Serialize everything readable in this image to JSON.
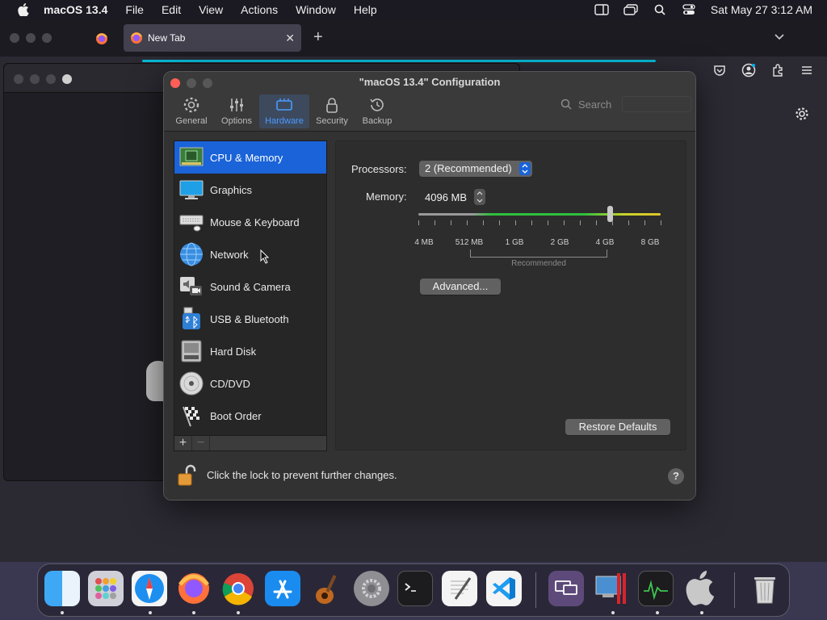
{
  "menubar": {
    "app_name": "macOS 13.4",
    "menus": [
      "File",
      "Edit",
      "View",
      "Actions",
      "Window",
      "Help"
    ],
    "datetime": "Sat May 27  3:12 AM"
  },
  "browser": {
    "tab_title": "New Tab",
    "tab_close": "✕",
    "new_tab": "+"
  },
  "dialog": {
    "title": "\"macOS 13.4\" Configuration",
    "toolbar": [
      {
        "label": "General",
        "icon": "gear-icon"
      },
      {
        "label": "Options",
        "icon": "sliders-icon"
      },
      {
        "label": "Hardware",
        "icon": "chip-icon",
        "active": true
      },
      {
        "label": "Security",
        "icon": "lock-icon"
      },
      {
        "label": "Backup",
        "icon": "clock-arrow-icon"
      }
    ],
    "search_placeholder": "Search",
    "sidebar": [
      {
        "label": "CPU & Memory",
        "icon": "cpu-memory-icon",
        "selected": true
      },
      {
        "label": "Graphics",
        "icon": "display-icon"
      },
      {
        "label": "Mouse & Keyboard",
        "icon": "keyboard-icon"
      },
      {
        "label": "Network",
        "icon": "globe-icon"
      },
      {
        "label": "Sound & Camera",
        "icon": "speaker-camera-icon"
      },
      {
        "label": "USB & Bluetooth",
        "icon": "usb-bluetooth-icon"
      },
      {
        "label": "Hard Disk",
        "icon": "hard-disk-icon"
      },
      {
        "label": "CD/DVD",
        "icon": "cd-dvd-icon"
      },
      {
        "label": "Boot Order",
        "icon": "checkered-flag-icon"
      }
    ],
    "sidebar_add": "+",
    "sidebar_remove": "−",
    "processors_label": "Processors:",
    "processors_value": "2 (Recommended)",
    "memory_label": "Memory:",
    "memory_value": "4096 MB",
    "memory_scale": [
      "4 MB",
      "512 MB",
      "1 GB",
      "2 GB",
      "4 GB",
      "8 GB"
    ],
    "memory_recommended": "Recommended",
    "memory_level_fraction": 0.79,
    "advanced_button": "Advanced...",
    "restore_button": "Restore Defaults",
    "lock_text": "Click the lock to prevent further changes.",
    "help_button": "?"
  },
  "dock": {
    "items": [
      "Finder",
      "Launchpad",
      "Safari",
      "Firefox",
      "Chrome",
      "App Store",
      "GarageBand",
      "System Settings",
      "Terminal",
      "TextEdit",
      "Visual Studio Code",
      "Screen Sharing",
      "Parallels Desktop",
      "Activity Monitor",
      "macOS",
      "Trash"
    ]
  }
}
